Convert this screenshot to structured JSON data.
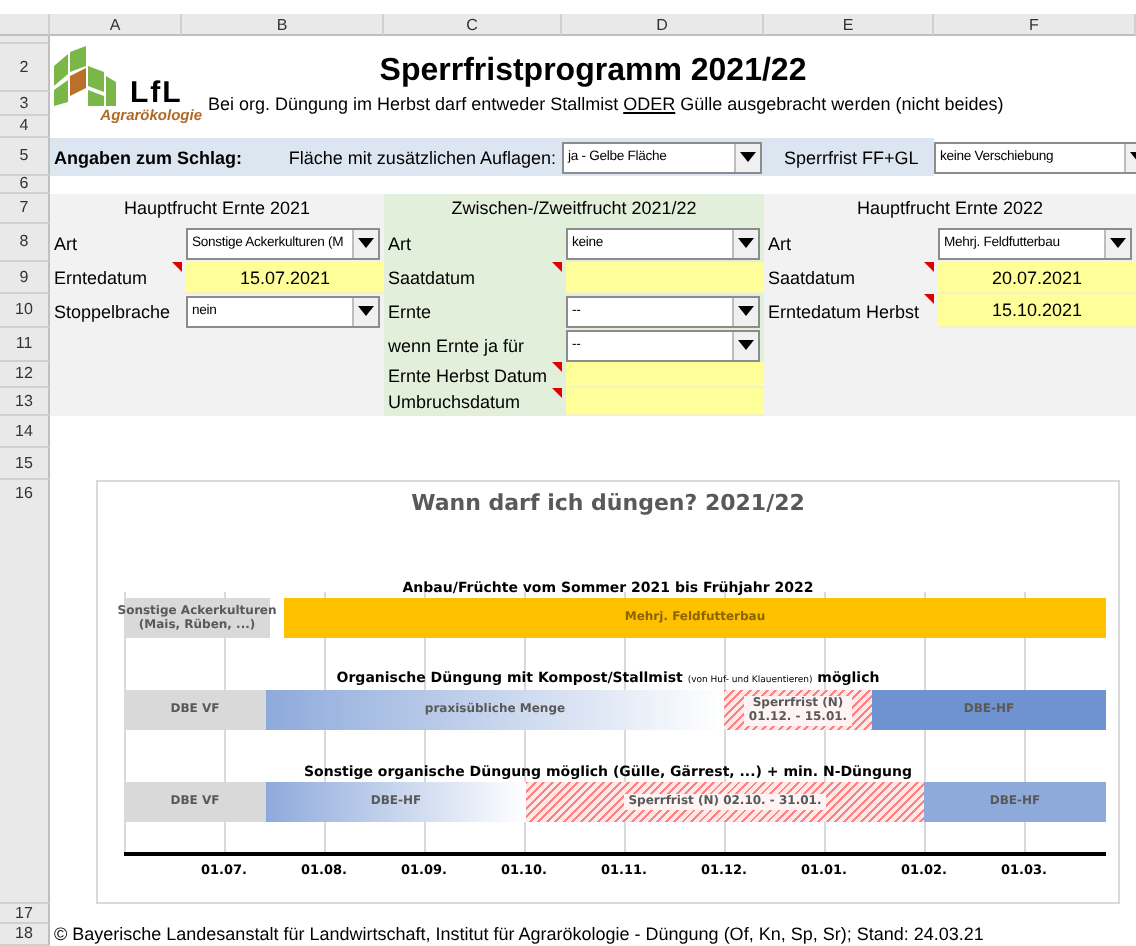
{
  "columns": [
    "A",
    "B",
    "C",
    "D",
    "E",
    "F"
  ],
  "row_numbers": [
    "2",
    "3",
    "4",
    "5",
    "6",
    "7",
    "8",
    "9",
    "10",
    "11",
    "12",
    "13",
    "14",
    "15",
    "16",
    "17",
    "18"
  ],
  "logo": {
    "name": "LfL",
    "subtitle": "Agrarökologie"
  },
  "title": "Sperrfristprogramm 2021/22",
  "note": [
    {
      "text": "Bei org. Düngung im Herbst darf entweder Stallmist",
      "underline": false
    },
    {
      "text": "ODER",
      "underline": true
    },
    {
      "text": "Gülle ausgebracht werden (nicht beides)",
      "underline": false
    }
  ],
  "settings": {
    "heading": "Angaben zum Schlag:",
    "area_label": "Fläche mit zusätzlichen Auflagen:",
    "area_value": "ja - Gelbe Fläche",
    "shift_label": "Sperrfrist FF+GL",
    "shift_value": "keine Verschiebung"
  },
  "sections": [
    {
      "heading": "Hauptfrucht Ernte 2021",
      "kind": "main",
      "fields": [
        {
          "label": "Art",
          "kind": "dropdown",
          "value": "Sonstige Ackerkulturen (M",
          "comment": false
        },
        {
          "label": "Erntedatum",
          "kind": "date",
          "value": "15.07.2021",
          "comment": true
        },
        {
          "label": "Stoppelbrache",
          "kind": "dropdown",
          "value": "nein",
          "comment": false
        }
      ]
    },
    {
      "heading": "Zwischen-/Zweitfrucht 2021/22",
      "kind": "catch",
      "fields": [
        {
          "label": "Art",
          "kind": "dropdown",
          "value": "keine",
          "comment": false
        },
        {
          "label": "Saatdatum",
          "kind": "date",
          "comment": true
        },
        {
          "label": "Ernte",
          "kind": "dropdown",
          "value": "--",
          "comment": false
        },
        {
          "label": "wenn Ernte ja für",
          "kind": "dropdown",
          "value": "--",
          "comment": false
        },
        {
          "label": "Ernte Herbst Datum",
          "kind": "date",
          "comment": true
        },
        {
          "label": "Umbruchsdatum",
          "kind": "date",
          "comment": true
        }
      ]
    },
    {
      "heading": "Hauptfrucht Ernte 2022",
      "kind": "main",
      "fields": [
        {
          "label": "Art",
          "kind": "dropdown",
          "value": "Mehrj. Feldfutterbau",
          "comment": false
        },
        {
          "label": "Saatdatum",
          "kind": "date",
          "value": "20.07.2021",
          "comment": true
        },
        {
          "label": "Erntedatum Herbst",
          "kind": "date",
          "value": "15.10.2021",
          "comment": true
        }
      ]
    }
  ],
  "chart": {
    "title": "Wann darf ich düngen? 2021/22",
    "rows": [
      {
        "heading": [
          {
            "text": "Anbau/Früchte vom Sommer 2021 bis Frühjahr 2022",
            "small": false
          }
        ],
        "segments": [
          {
            "kind": "grey",
            "lines": [
              "Sonstige Ackerkulturen",
              "(Mais, Rüben, ...)"
            ]
          },
          {
            "kind": "orange",
            "lines": [
              "Mehrj. Feldfutterbau"
            ]
          }
        ]
      },
      {
        "heading": [
          {
            "text": "Organische Düngung mit Kompost/Stallmist",
            "small": false
          },
          {
            "text": "(von Huf- und Klauentieren)",
            "small": true
          },
          {
            "text": "möglich",
            "small": false
          }
        ],
        "segments": [
          {
            "kind": "grey",
            "lines": [
              "DBE VF"
            ]
          },
          {
            "kind": "gradient",
            "lines": [
              "praxisübliche Menge"
            ]
          },
          {
            "kind": "hatch",
            "lines": [
              "Sperrfrist (N)",
              "01.12. - 15.01."
            ]
          },
          {
            "kind": "blue",
            "lines": [
              "DBE-HF"
            ]
          }
        ]
      },
      {
        "heading": [
          {
            "text": "Sonstige organische Düngung möglich (Gülle, Gärrest, ...) + min. N-Düngung",
            "small": false
          }
        ],
        "segments": [
          {
            "kind": "grey",
            "lines": [
              "DBE VF"
            ]
          },
          {
            "kind": "gradient",
            "lines": [
              "DBE-HF"
            ]
          },
          {
            "kind": "hatch",
            "lines": [
              "Sperrfrist (N) 02.10. - 31.01."
            ]
          },
          {
            "kind": "light-blue",
            "lines": [
              "DBE-HF"
            ]
          }
        ]
      }
    ],
    "axis_labels": [
      "01.07.",
      "01.08.",
      "01.09.",
      "01.10.",
      "01.11.",
      "01.12.",
      "01.01.",
      "01.02.",
      "01.03."
    ]
  },
  "footer": "© Bayerische Landesanstalt für Landwirtschaft, Institut für Agrarökologie - Düngung (Of, Kn, Sp, Sr); Stand: 24.03.21"
}
